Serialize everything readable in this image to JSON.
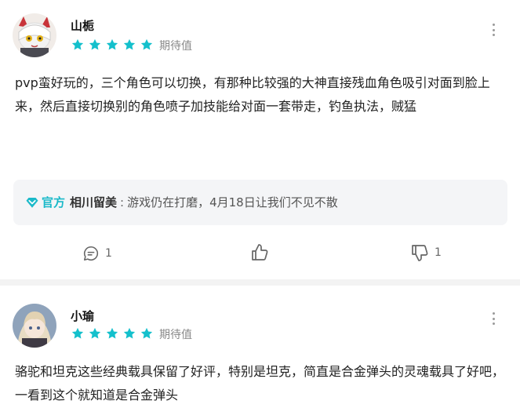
{
  "reviews": [
    {
      "username": "山栀",
      "stars": 5,
      "rating_label": "期待值",
      "body": "pvp蛮好玩的，三个角色可以切换，有那种比较强的大神直接残血角色吸引对面到脸上来，然后直接切换别的角色喷子加技能给对面一套带走，钓鱼执法，贼猛",
      "reply": {
        "official_label": "官方",
        "developer": "相川留美",
        "separator": ":",
        "text": "游戏仍在打磨，4月18日让我们不见不散"
      },
      "actions": {
        "comment_count": "1",
        "dislike_count": "1"
      }
    },
    {
      "username": "小瑜",
      "stars": 5,
      "rating_label": "期待值",
      "body": "骆驼和坦克这些经典载具保留了好评，特别是坦克，简直是合金弹头的灵魂载具了好吧，一看到这个就知道是合金弹头"
    }
  ],
  "colors": {
    "star": "#14c0cc",
    "official": "#1ab9c9",
    "reply_bg": "#f4f5f7",
    "divider": "#f3f3f3"
  },
  "icons": [
    "more-vertical-icon",
    "star-icon",
    "official-badge-icon",
    "comment-icon",
    "thumbs-up-icon",
    "thumbs-down-icon"
  ]
}
